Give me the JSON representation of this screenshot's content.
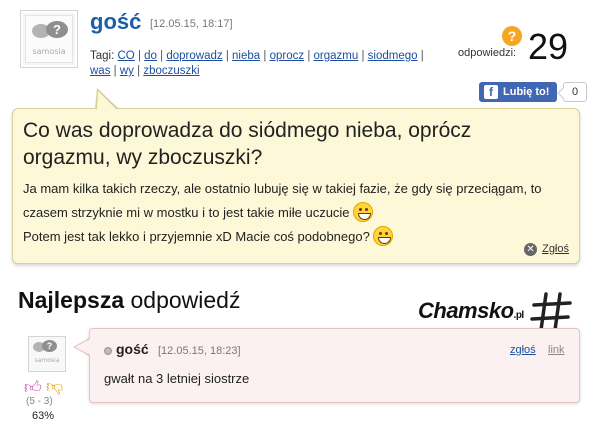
{
  "question": {
    "author": "gość",
    "date": "[12.05.15, 18:17]",
    "avatar_caption": "samosia",
    "tags_label": "Tagi:",
    "tags": [
      "CO",
      "do",
      "doprowadz",
      "nieba",
      "oprocz",
      "orgazmu",
      "siodmego",
      "was",
      "wy",
      "zboczuszki"
    ],
    "answers_label": "odpowiedzi:",
    "answers_count": "29",
    "like_label": "Lubię to!",
    "like_count": "0",
    "title": "Co was doprowadza do siódmego nieba, oprócz orgazmu, wy zboczuszki?",
    "body_part1": "Ja mam kilka takich rzeczy, ale ostatnio lubuję się w takiej fazie, że gdy się przeciągam, to czasem strzyknie mi w mostku i to jest takie miłe uczucie",
    "body_part2": "Potem jest tak lekko i przyjemnie xD Macie coś podobnego?",
    "report_label": "Zgłoś"
  },
  "best_answer": {
    "heading_bold": "Najlepsza",
    "heading_rest": " odpowiedź",
    "logo_text": "Chamsko",
    "logo_suffix": ".pl",
    "author": "gość",
    "date": "[12.05.15, 18:23]",
    "report_label": "zgłoś",
    "link_label": "link",
    "text": "gwałt na 3 letniej siostrze",
    "avatar_caption": "samosia",
    "votes": "(5 - 3)",
    "percent": "63%"
  },
  "colors": {
    "author_blue": "#1c5fa8",
    "question_bg": "#fdf8d8",
    "answer_bg": "#fcf1f1",
    "facebook": "#4267b2",
    "badge_orange": "#f5a623"
  }
}
